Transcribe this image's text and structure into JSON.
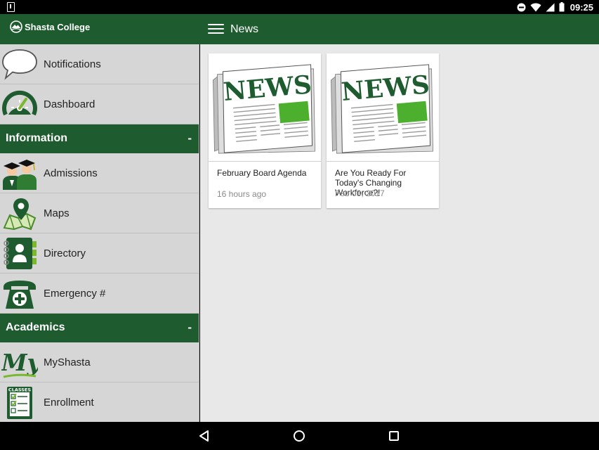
{
  "status_bar": {
    "time": "09:25",
    "icons": [
      "download-icon",
      "do-not-disturb-icon",
      "wifi-icon",
      "signal-icon",
      "battery-icon"
    ]
  },
  "app_bar": {
    "brand": "Shasta College",
    "title": "News",
    "color": "#1e5c30"
  },
  "sidebar": {
    "top_items": [
      {
        "label": "Notifications",
        "icon": "speech-bubble-icon"
      },
      {
        "label": "Dashboard",
        "icon": "speedometer-icon"
      }
    ],
    "sections": [
      {
        "title": "Information",
        "toggle": "-",
        "items": [
          {
            "label": "Admissions",
            "icon": "graduates-icon"
          },
          {
            "label": "Maps",
            "icon": "map-pin-icon"
          },
          {
            "label": "Directory",
            "icon": "contact-book-icon"
          },
          {
            "label": "Emergency #",
            "icon": "emergency-phone-icon"
          }
        ]
      },
      {
        "title": "Academics",
        "toggle": "-",
        "items": [
          {
            "label": "MyShasta",
            "icon": "myshasta-logo-icon",
            "logo_text": "My"
          },
          {
            "label": "Enrollment",
            "icon": "classes-checklist-icon",
            "logo_text": "CLASSES"
          }
        ]
      }
    ]
  },
  "news": {
    "thumbnail_text": "NEWS",
    "cards": [
      {
        "title": "February Board Agenda",
        "date": "16 hours ago"
      },
      {
        "title": "Are You Ready For Today's Changing Workforce?!",
        "date": "Feb 03, 2017"
      }
    ]
  }
}
